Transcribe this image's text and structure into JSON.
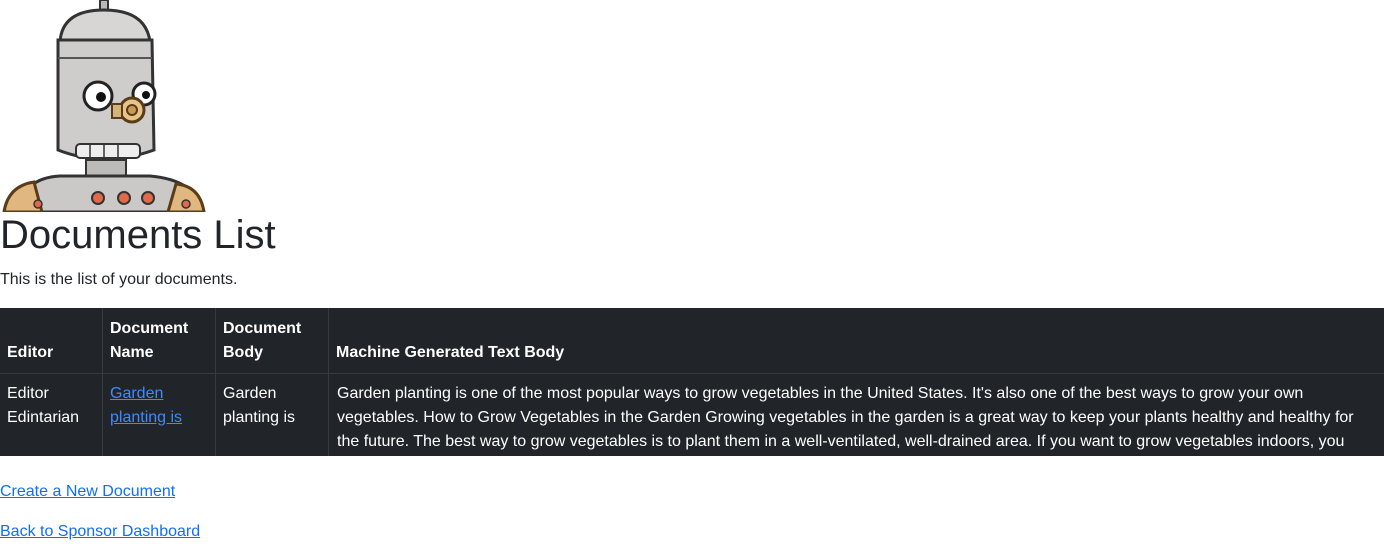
{
  "page": {
    "title": "Documents List",
    "intro": "This is the list of your documents."
  },
  "logo": {
    "icon": "robot-mascot-icon"
  },
  "table": {
    "headers": {
      "editor": "Editor",
      "document_name": "Document Name",
      "document_body": "Document Body",
      "machine_text": "Machine Generated Text Body"
    },
    "rows": [
      {
        "editor": "Editor Edintarian",
        "document_name": "Garden planting is",
        "document_body": "Garden planting is",
        "machine_text": "Garden planting is one of the most popular ways to grow vegetables in the United States. It's also one of the best ways to grow your own vegetables. How to Grow Vegetables in the Garden Growing vegetables in the garden is a great way to keep your plants healthy and healthy for the future. The best way to grow vegetables is to plant them in a well-ventilated, well-drained area. If you want to grow vegetables indoors, you"
      }
    ]
  },
  "links": {
    "create": "Create a New Document",
    "back": "Back to Sponsor Dashboard"
  },
  "colors": {
    "table_bg": "#212529",
    "link": "#0d6efd",
    "text": "#212529"
  }
}
